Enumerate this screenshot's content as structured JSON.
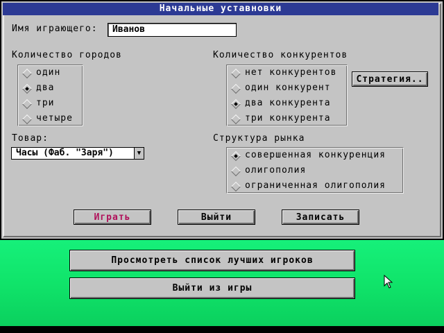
{
  "dialog": {
    "title": "Начальные уставновки",
    "player_label": "Имя играющего:",
    "player_value": "Иванов",
    "cities": {
      "title": "Количество городов",
      "options": [
        {
          "label": "один",
          "selected": false
        },
        {
          "label": "два",
          "selected": true
        },
        {
          "label": "три",
          "selected": false
        },
        {
          "label": "четыре",
          "selected": false
        }
      ]
    },
    "competitors": {
      "title": "Количество конкурентов",
      "options": [
        {
          "label": "нет конкурентов",
          "selected": false
        },
        {
          "label": "один конкурент",
          "selected": false
        },
        {
          "label": "два конкурента",
          "selected": true
        },
        {
          "label": "три конкурента",
          "selected": false
        }
      ],
      "strategy_button": "Стратегия.."
    },
    "product": {
      "title": "Товар:",
      "value": "Часы (Фаб. \"Заря\")"
    },
    "market": {
      "title": "Структура рынка",
      "options": [
        {
          "label": "совершенная конкуренция",
          "selected": true
        },
        {
          "label": "олигополия",
          "selected": false
        },
        {
          "label": "ограниченная олигополия",
          "selected": false
        }
      ]
    },
    "buttons": {
      "play": "Играть",
      "exit": "Выйти",
      "save": "Записать"
    },
    "colors": {
      "title_bar": "#2c3a94",
      "play_text": "#b0105a",
      "dialog_bg": "#c4c4c4",
      "desktop": "#10e46a"
    }
  },
  "desktop": {
    "view_best_button": "Просмотреть список лучших игроков",
    "quit_button": "Выйти из игры"
  }
}
